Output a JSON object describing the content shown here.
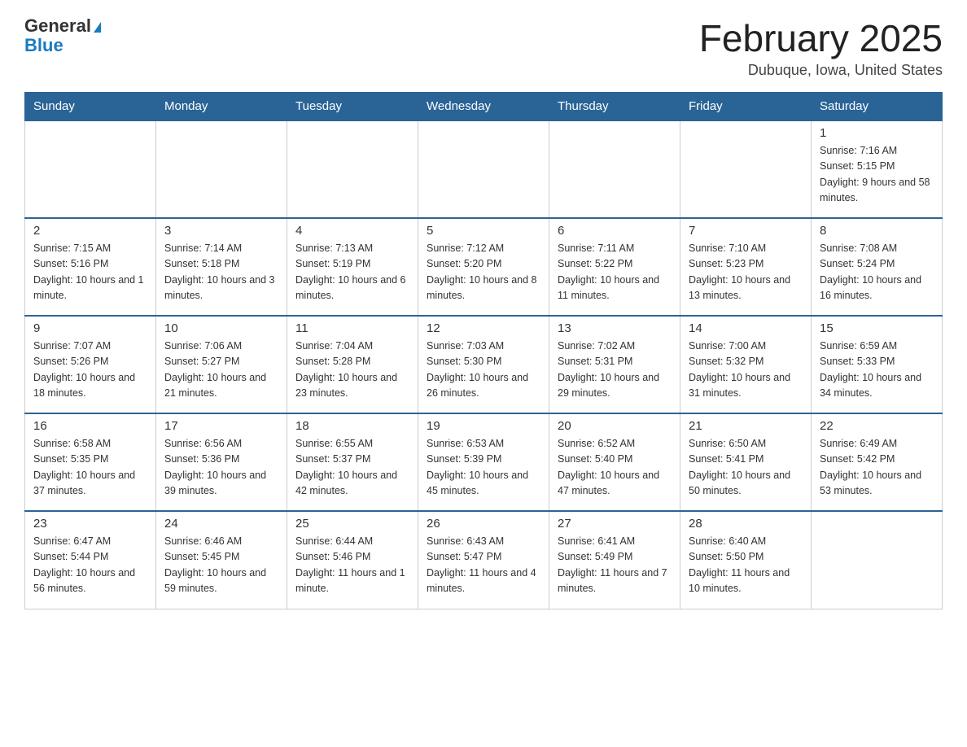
{
  "logo": {
    "general": "General",
    "blue": "Blue"
  },
  "header": {
    "title": "February 2025",
    "location": "Dubuque, Iowa, United States"
  },
  "weekdays": [
    "Sunday",
    "Monday",
    "Tuesday",
    "Wednesday",
    "Thursday",
    "Friday",
    "Saturday"
  ],
  "weeks": [
    [
      {
        "day": "",
        "info": ""
      },
      {
        "day": "",
        "info": ""
      },
      {
        "day": "",
        "info": ""
      },
      {
        "day": "",
        "info": ""
      },
      {
        "day": "",
        "info": ""
      },
      {
        "day": "",
        "info": ""
      },
      {
        "day": "1",
        "info": "Sunrise: 7:16 AM\nSunset: 5:15 PM\nDaylight: 9 hours and 58 minutes."
      }
    ],
    [
      {
        "day": "2",
        "info": "Sunrise: 7:15 AM\nSunset: 5:16 PM\nDaylight: 10 hours and 1 minute."
      },
      {
        "day": "3",
        "info": "Sunrise: 7:14 AM\nSunset: 5:18 PM\nDaylight: 10 hours and 3 minutes."
      },
      {
        "day": "4",
        "info": "Sunrise: 7:13 AM\nSunset: 5:19 PM\nDaylight: 10 hours and 6 minutes."
      },
      {
        "day": "5",
        "info": "Sunrise: 7:12 AM\nSunset: 5:20 PM\nDaylight: 10 hours and 8 minutes."
      },
      {
        "day": "6",
        "info": "Sunrise: 7:11 AM\nSunset: 5:22 PM\nDaylight: 10 hours and 11 minutes."
      },
      {
        "day": "7",
        "info": "Sunrise: 7:10 AM\nSunset: 5:23 PM\nDaylight: 10 hours and 13 minutes."
      },
      {
        "day": "8",
        "info": "Sunrise: 7:08 AM\nSunset: 5:24 PM\nDaylight: 10 hours and 16 minutes."
      }
    ],
    [
      {
        "day": "9",
        "info": "Sunrise: 7:07 AM\nSunset: 5:26 PM\nDaylight: 10 hours and 18 minutes."
      },
      {
        "day": "10",
        "info": "Sunrise: 7:06 AM\nSunset: 5:27 PM\nDaylight: 10 hours and 21 minutes."
      },
      {
        "day": "11",
        "info": "Sunrise: 7:04 AM\nSunset: 5:28 PM\nDaylight: 10 hours and 23 minutes."
      },
      {
        "day": "12",
        "info": "Sunrise: 7:03 AM\nSunset: 5:30 PM\nDaylight: 10 hours and 26 minutes."
      },
      {
        "day": "13",
        "info": "Sunrise: 7:02 AM\nSunset: 5:31 PM\nDaylight: 10 hours and 29 minutes."
      },
      {
        "day": "14",
        "info": "Sunrise: 7:00 AM\nSunset: 5:32 PM\nDaylight: 10 hours and 31 minutes."
      },
      {
        "day": "15",
        "info": "Sunrise: 6:59 AM\nSunset: 5:33 PM\nDaylight: 10 hours and 34 minutes."
      }
    ],
    [
      {
        "day": "16",
        "info": "Sunrise: 6:58 AM\nSunset: 5:35 PM\nDaylight: 10 hours and 37 minutes."
      },
      {
        "day": "17",
        "info": "Sunrise: 6:56 AM\nSunset: 5:36 PM\nDaylight: 10 hours and 39 minutes."
      },
      {
        "day": "18",
        "info": "Sunrise: 6:55 AM\nSunset: 5:37 PM\nDaylight: 10 hours and 42 minutes."
      },
      {
        "day": "19",
        "info": "Sunrise: 6:53 AM\nSunset: 5:39 PM\nDaylight: 10 hours and 45 minutes."
      },
      {
        "day": "20",
        "info": "Sunrise: 6:52 AM\nSunset: 5:40 PM\nDaylight: 10 hours and 47 minutes."
      },
      {
        "day": "21",
        "info": "Sunrise: 6:50 AM\nSunset: 5:41 PM\nDaylight: 10 hours and 50 minutes."
      },
      {
        "day": "22",
        "info": "Sunrise: 6:49 AM\nSunset: 5:42 PM\nDaylight: 10 hours and 53 minutes."
      }
    ],
    [
      {
        "day": "23",
        "info": "Sunrise: 6:47 AM\nSunset: 5:44 PM\nDaylight: 10 hours and 56 minutes."
      },
      {
        "day": "24",
        "info": "Sunrise: 6:46 AM\nSunset: 5:45 PM\nDaylight: 10 hours and 59 minutes."
      },
      {
        "day": "25",
        "info": "Sunrise: 6:44 AM\nSunset: 5:46 PM\nDaylight: 11 hours and 1 minute."
      },
      {
        "day": "26",
        "info": "Sunrise: 6:43 AM\nSunset: 5:47 PM\nDaylight: 11 hours and 4 minutes."
      },
      {
        "day": "27",
        "info": "Sunrise: 6:41 AM\nSunset: 5:49 PM\nDaylight: 11 hours and 7 minutes."
      },
      {
        "day": "28",
        "info": "Sunrise: 6:40 AM\nSunset: 5:50 PM\nDaylight: 11 hours and 10 minutes."
      },
      {
        "day": "",
        "info": ""
      }
    ]
  ]
}
